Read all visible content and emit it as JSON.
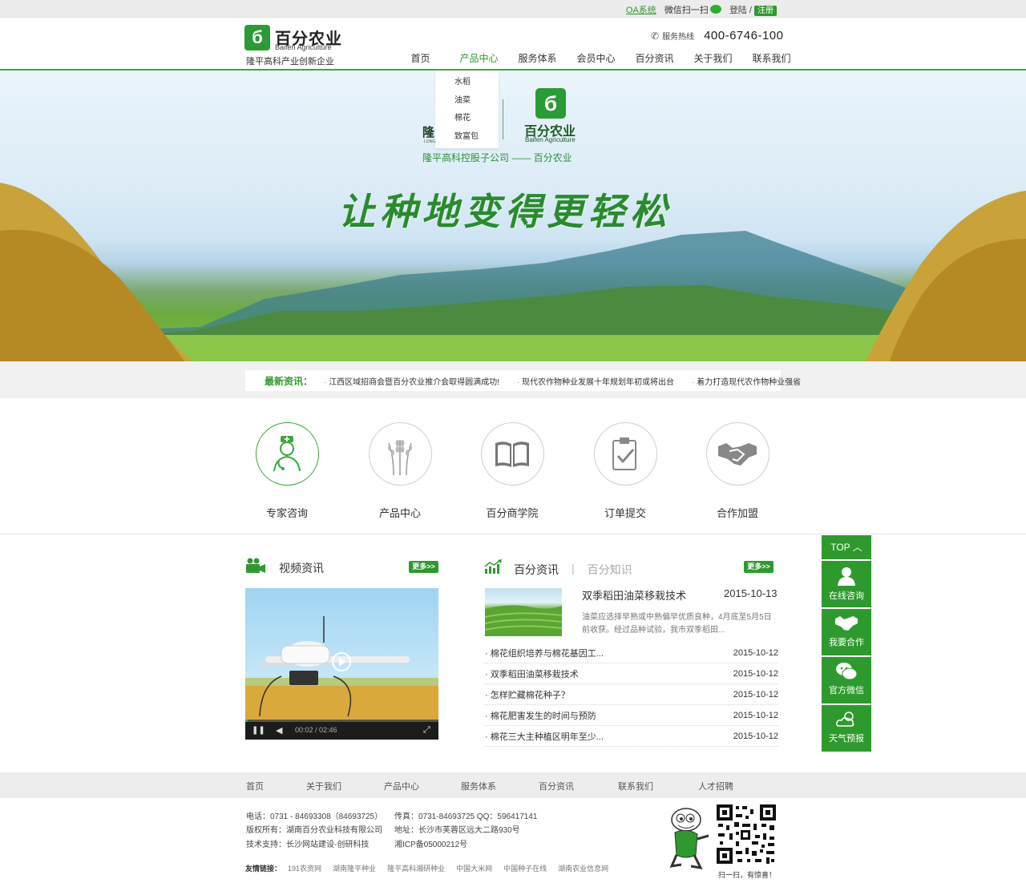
{
  "topbar": {
    "oa": "OA系统",
    "wechat": "微信扫一扫",
    "login": "登陆 /",
    "register": "注册"
  },
  "header": {
    "logo_cn": "百分农业",
    "logo_en": "Baifen Agriculture",
    "slogan": "隆平高科产业创新企业",
    "hotline_label": "服务热线",
    "hotline_number": "400-6746-100",
    "nav": [
      "首页",
      "产品中心",
      "服务体系",
      "会员中心",
      "百分资讯",
      "关于我们",
      "联系我们"
    ],
    "active_nav": "产品中心"
  },
  "dropdown": {
    "items": [
      "水稻",
      "油菜",
      "棉花",
      "致富包"
    ]
  },
  "banner": {
    "longping": "隆",
    "longping_en": "LONG",
    "brand_cn": "百分农业",
    "brand_en": "Baifen Agriculture",
    "subtitle": "隆平高科控股子公司 —— 百分农业",
    "headline": "让种地变得更轻松"
  },
  "ticker": {
    "label": "最新资讯：",
    "items": [
      "江西区域招商会暨百分农业推介会取得圆满成功!",
      "现代农作物种业发展十年规划年初或将出台",
      "着力打造现代农作物种业强省"
    ]
  },
  "quick_links": [
    {
      "label": "专家咨询",
      "icon": "doctor-icon",
      "active": true
    },
    {
      "label": "产品中心",
      "icon": "wheat-icon",
      "active": false
    },
    {
      "label": "百分商学院",
      "icon": "book-icon",
      "active": false
    },
    {
      "label": "订单提交",
      "icon": "clipboard-icon",
      "active": false
    },
    {
      "label": "合作加盟",
      "icon": "handshake-icon",
      "active": false
    }
  ],
  "video_section": {
    "title": "视频资讯",
    "more": "更多>>",
    "time": "00:02 / 02:46",
    "progress": 0.012
  },
  "news_section": {
    "tab_active": "百分资讯",
    "tab_inactive": "百分知识",
    "more": "更多>>",
    "featured": {
      "title": "双季稻田油菜移栽技术",
      "date": "2015-10-13",
      "desc": "油菜应选择早熟或中熟偏早优质良种，4月底至5月5日前收获。经过品种试验，我市双季稻田..."
    },
    "items": [
      {
        "title": "棉花组织培养与棉花基因工...",
        "date": "2015-10-12"
      },
      {
        "title": "双季稻田油菜移栽技术",
        "date": "2015-10-12"
      },
      {
        "title": "怎样贮藏棉花种子？",
        "date": "2015-10-12"
      },
      {
        "title": "棉花肥害发生的时间与预防",
        "date": "2015-10-12"
      },
      {
        "title": "棉花三大主种植区明年至少...",
        "date": "2015-10-12"
      }
    ]
  },
  "side_bar": {
    "top": "TOP",
    "buttons": [
      {
        "label": "在线咨询",
        "icon": "user-icon"
      },
      {
        "label": "我要合作",
        "icon": "handshake-icon"
      },
      {
        "label": "官方微信",
        "icon": "wechat-icon"
      },
      {
        "label": "天气预报",
        "icon": "weather-icon"
      }
    ]
  },
  "footer": {
    "nav": [
      "首页",
      "关于我们",
      "产品中心",
      "服务体系",
      "百分资讯",
      "联系我们",
      "人才招聘"
    ],
    "phone": "电话：0731 - 84693308（84693725）",
    "fax": "传真：0731-84693725   QQ：596417141",
    "copyright": "版权所有：湖南百分农业科技有限公司",
    "address": "地址：长沙市芙蓉区远大二路930号",
    "tech": "技术支持：长沙网站建设-创研科技",
    "icp": "湘ICP备05000212号",
    "friend_label": "友情链接：",
    "friend_links": [
      "191农资网",
      "湖南隆平种业",
      "隆平高科湘研种业",
      "中国大米网",
      "中国种子在线",
      "湖南农业信息网"
    ],
    "qr_caption": "扫一扫，有惊喜！"
  },
  "colors": {
    "brand_green": "#2e9a2e",
    "light_gray": "#ededed"
  }
}
